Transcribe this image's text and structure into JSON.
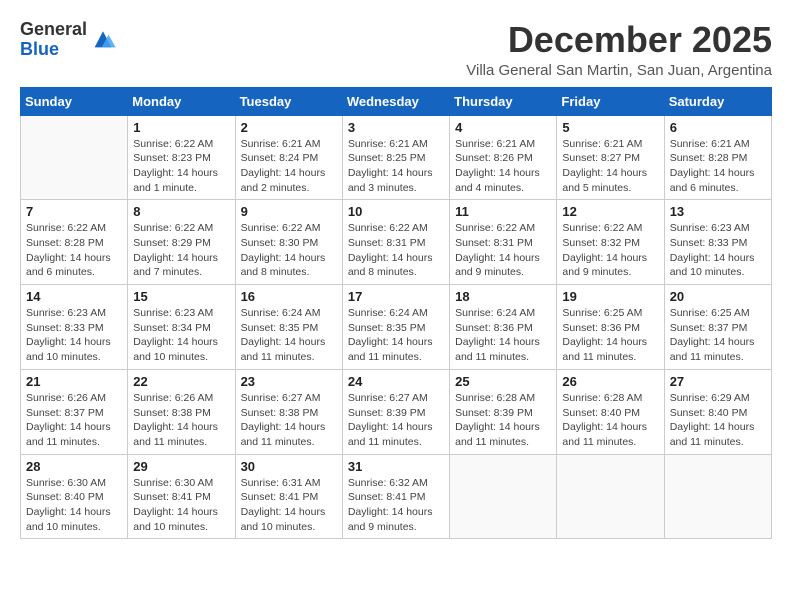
{
  "header": {
    "logo_text_general": "General",
    "logo_text_blue": "Blue",
    "month_title": "December 2025",
    "subtitle": "Villa General San Martin, San Juan, Argentina"
  },
  "days_of_week": [
    "Sunday",
    "Monday",
    "Tuesday",
    "Wednesday",
    "Thursday",
    "Friday",
    "Saturday"
  ],
  "weeks": [
    [
      {
        "day": "",
        "info": ""
      },
      {
        "day": "1",
        "info": "Sunrise: 6:22 AM\nSunset: 8:23 PM\nDaylight: 14 hours\nand 1 minute."
      },
      {
        "day": "2",
        "info": "Sunrise: 6:21 AM\nSunset: 8:24 PM\nDaylight: 14 hours\nand 2 minutes."
      },
      {
        "day": "3",
        "info": "Sunrise: 6:21 AM\nSunset: 8:25 PM\nDaylight: 14 hours\nand 3 minutes."
      },
      {
        "day": "4",
        "info": "Sunrise: 6:21 AM\nSunset: 8:26 PM\nDaylight: 14 hours\nand 4 minutes."
      },
      {
        "day": "5",
        "info": "Sunrise: 6:21 AM\nSunset: 8:27 PM\nDaylight: 14 hours\nand 5 minutes."
      },
      {
        "day": "6",
        "info": "Sunrise: 6:21 AM\nSunset: 8:28 PM\nDaylight: 14 hours\nand 6 minutes."
      }
    ],
    [
      {
        "day": "7",
        "info": "Sunrise: 6:22 AM\nSunset: 8:28 PM\nDaylight: 14 hours\nand 6 minutes."
      },
      {
        "day": "8",
        "info": "Sunrise: 6:22 AM\nSunset: 8:29 PM\nDaylight: 14 hours\nand 7 minutes."
      },
      {
        "day": "9",
        "info": "Sunrise: 6:22 AM\nSunset: 8:30 PM\nDaylight: 14 hours\nand 8 minutes."
      },
      {
        "day": "10",
        "info": "Sunrise: 6:22 AM\nSunset: 8:31 PM\nDaylight: 14 hours\nand 8 minutes."
      },
      {
        "day": "11",
        "info": "Sunrise: 6:22 AM\nSunset: 8:31 PM\nDaylight: 14 hours\nand 9 minutes."
      },
      {
        "day": "12",
        "info": "Sunrise: 6:22 AM\nSunset: 8:32 PM\nDaylight: 14 hours\nand 9 minutes."
      },
      {
        "day": "13",
        "info": "Sunrise: 6:23 AM\nSunset: 8:33 PM\nDaylight: 14 hours\nand 10 minutes."
      }
    ],
    [
      {
        "day": "14",
        "info": "Sunrise: 6:23 AM\nSunset: 8:33 PM\nDaylight: 14 hours\nand 10 minutes."
      },
      {
        "day": "15",
        "info": "Sunrise: 6:23 AM\nSunset: 8:34 PM\nDaylight: 14 hours\nand 10 minutes."
      },
      {
        "day": "16",
        "info": "Sunrise: 6:24 AM\nSunset: 8:35 PM\nDaylight: 14 hours\nand 11 minutes."
      },
      {
        "day": "17",
        "info": "Sunrise: 6:24 AM\nSunset: 8:35 PM\nDaylight: 14 hours\nand 11 minutes."
      },
      {
        "day": "18",
        "info": "Sunrise: 6:24 AM\nSunset: 8:36 PM\nDaylight: 14 hours\nand 11 minutes."
      },
      {
        "day": "19",
        "info": "Sunrise: 6:25 AM\nSunset: 8:36 PM\nDaylight: 14 hours\nand 11 minutes."
      },
      {
        "day": "20",
        "info": "Sunrise: 6:25 AM\nSunset: 8:37 PM\nDaylight: 14 hours\nand 11 minutes."
      }
    ],
    [
      {
        "day": "21",
        "info": "Sunrise: 6:26 AM\nSunset: 8:37 PM\nDaylight: 14 hours\nand 11 minutes."
      },
      {
        "day": "22",
        "info": "Sunrise: 6:26 AM\nSunset: 8:38 PM\nDaylight: 14 hours\nand 11 minutes."
      },
      {
        "day": "23",
        "info": "Sunrise: 6:27 AM\nSunset: 8:38 PM\nDaylight: 14 hours\nand 11 minutes."
      },
      {
        "day": "24",
        "info": "Sunrise: 6:27 AM\nSunset: 8:39 PM\nDaylight: 14 hours\nand 11 minutes."
      },
      {
        "day": "25",
        "info": "Sunrise: 6:28 AM\nSunset: 8:39 PM\nDaylight: 14 hours\nand 11 minutes."
      },
      {
        "day": "26",
        "info": "Sunrise: 6:28 AM\nSunset: 8:40 PM\nDaylight: 14 hours\nand 11 minutes."
      },
      {
        "day": "27",
        "info": "Sunrise: 6:29 AM\nSunset: 8:40 PM\nDaylight: 14 hours\nand 11 minutes."
      }
    ],
    [
      {
        "day": "28",
        "info": "Sunrise: 6:30 AM\nSunset: 8:40 PM\nDaylight: 14 hours\nand 10 minutes."
      },
      {
        "day": "29",
        "info": "Sunrise: 6:30 AM\nSunset: 8:41 PM\nDaylight: 14 hours\nand 10 minutes."
      },
      {
        "day": "30",
        "info": "Sunrise: 6:31 AM\nSunset: 8:41 PM\nDaylight: 14 hours\nand 10 minutes."
      },
      {
        "day": "31",
        "info": "Sunrise: 6:32 AM\nSunset: 8:41 PM\nDaylight: 14 hours\nand 9 minutes."
      },
      {
        "day": "",
        "info": ""
      },
      {
        "day": "",
        "info": ""
      },
      {
        "day": "",
        "info": ""
      }
    ]
  ]
}
